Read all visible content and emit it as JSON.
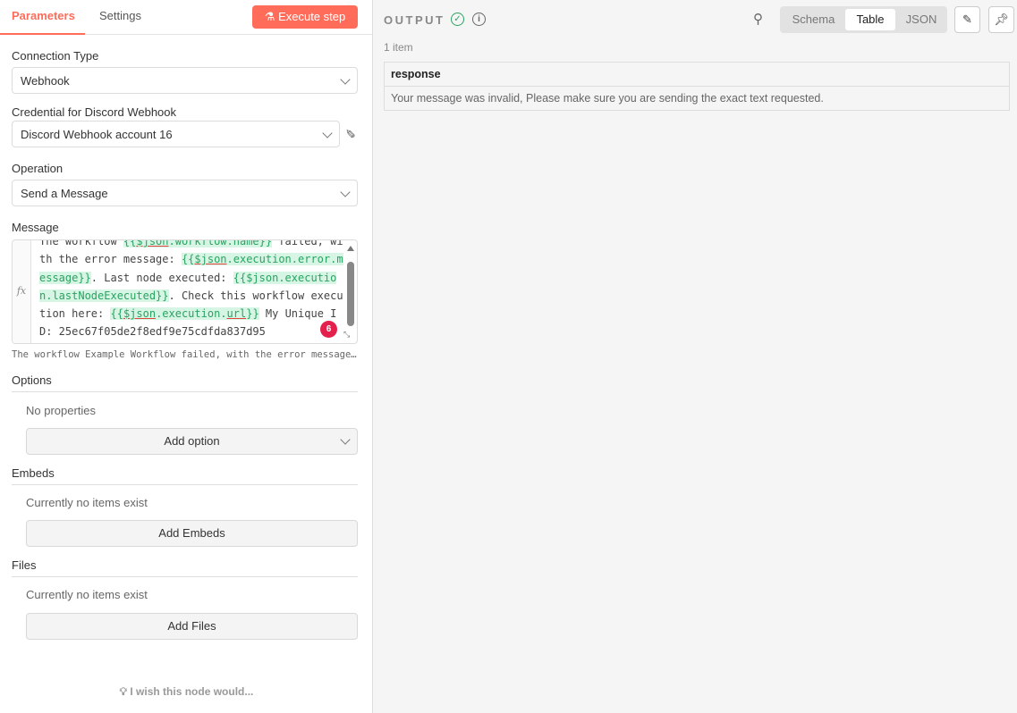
{
  "tabs": {
    "parameters": "Parameters",
    "settings": "Settings"
  },
  "execute_label": "Execute step",
  "connection": {
    "label": "Connection Type",
    "value": "Webhook"
  },
  "credential": {
    "label": "Credential for Discord Webhook",
    "value": "Discord Webhook account 16"
  },
  "operation": {
    "label": "Operation",
    "value": "Send a Message"
  },
  "message": {
    "label": "Message",
    "fx": "fx",
    "lines": [
      [
        {
          "t": "The workflow "
        },
        {
          "t": "{{",
          "h": 1
        },
        {
          "t": "$json",
          "h": 1,
          "u": 1
        },
        {
          "t": ".workflow.name}}",
          "h": 1
        },
        {
          "t": " failed, wi"
        }
      ],
      [
        {
          "t": "th the error message: "
        },
        {
          "t": "{{",
          "h": 1
        },
        {
          "t": "$json",
          "h": 1,
          "u": 1
        },
        {
          "t": ".execution.error.m",
          "h": 1
        }
      ],
      [
        {
          "t": "essage}}",
          "h": 1
        },
        {
          "t": ". Last node executed: "
        },
        {
          "t": "{{$json.executio",
          "h": 1
        }
      ],
      [
        {
          "t": "n.lastNodeExecuted}}",
          "h": 1
        },
        {
          "t": ". Check this workflow execu"
        }
      ],
      [
        {
          "t": "tion here: "
        },
        {
          "t": "{{",
          "h": 1
        },
        {
          "t": "$json",
          "h": 1,
          "u": 1
        },
        {
          "t": ".execution.",
          "h": 1
        },
        {
          "t": "url",
          "h": 1,
          "u": 1
        },
        {
          "t": "}}",
          "h": 1
        },
        {
          "t": " My Unique I"
        }
      ],
      [
        {
          "t": "D: 25ec67f05de2f8edf9e75cdfda837d95"
        }
      ]
    ],
    "badge": "6",
    "preview": "The workflow Example Workflow failed, with the error message: …"
  },
  "options": {
    "title": "Options",
    "empty": "No properties",
    "button": "Add option"
  },
  "embeds": {
    "title": "Embeds",
    "empty": "Currently no items exist",
    "button": "Add Embeds"
  },
  "files": {
    "title": "Files",
    "empty": "Currently no items exist",
    "button": "Add Files"
  },
  "wish": "I wish this node would...",
  "output": {
    "title": "OUTPUT",
    "views": [
      "Schema",
      "Table",
      "JSON"
    ],
    "active_view": "Table",
    "count": "1 item",
    "column": "response",
    "value": "Your message was invalid, Please make sure you are sending the exact text requested."
  }
}
